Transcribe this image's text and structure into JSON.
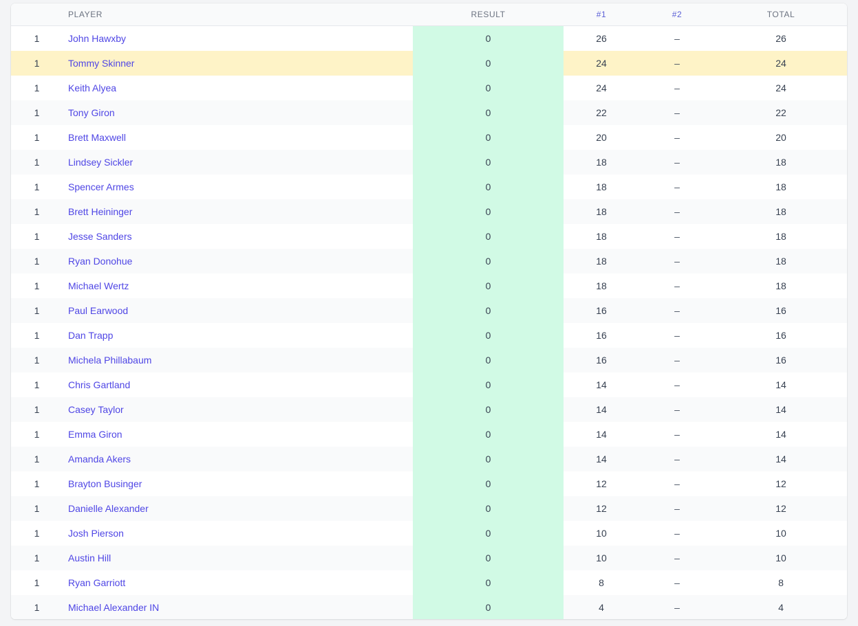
{
  "columns": {
    "position": "",
    "player": "PLAYER",
    "result": "RESULT",
    "round1": "#1",
    "round2": "#2",
    "total": "TOTAL"
  },
  "highlight_color": "#fef3c7",
  "result_column_color": "#d1fae5",
  "link_color": "#4f46e5",
  "rows": [
    {
      "pos": "1",
      "player": "John Hawxby",
      "result": "0",
      "r1": "26",
      "r2": "–",
      "total": "26"
    },
    {
      "pos": "1",
      "player": "Tommy Skinner",
      "result": "0",
      "r1": "24",
      "r2": "–",
      "total": "24",
      "highlight": true
    },
    {
      "pos": "1",
      "player": "Keith Alyea",
      "result": "0",
      "r1": "24",
      "r2": "–",
      "total": "24"
    },
    {
      "pos": "1",
      "player": "Tony Giron",
      "result": "0",
      "r1": "22",
      "r2": "–",
      "total": "22"
    },
    {
      "pos": "1",
      "player": "Brett Maxwell",
      "result": "0",
      "r1": "20",
      "r2": "–",
      "total": "20"
    },
    {
      "pos": "1",
      "player": "Lindsey Sickler",
      "result": "0",
      "r1": "18",
      "r2": "–",
      "total": "18"
    },
    {
      "pos": "1",
      "player": "Spencer Armes",
      "result": "0",
      "r1": "18",
      "r2": "–",
      "total": "18"
    },
    {
      "pos": "1",
      "player": "Brett Heininger",
      "result": "0",
      "r1": "18",
      "r2": "–",
      "total": "18"
    },
    {
      "pos": "1",
      "player": "Jesse Sanders",
      "result": "0",
      "r1": "18",
      "r2": "–",
      "total": "18"
    },
    {
      "pos": "1",
      "player": "Ryan Donohue",
      "result": "0",
      "r1": "18",
      "r2": "–",
      "total": "18"
    },
    {
      "pos": "1",
      "player": "Michael Wertz",
      "result": "0",
      "r1": "18",
      "r2": "–",
      "total": "18"
    },
    {
      "pos": "1",
      "player": "Paul Earwood",
      "result": "0",
      "r1": "16",
      "r2": "–",
      "total": "16"
    },
    {
      "pos": "1",
      "player": "Dan Trapp",
      "result": "0",
      "r1": "16",
      "r2": "–",
      "total": "16"
    },
    {
      "pos": "1",
      "player": "Michela Phillabaum",
      "result": "0",
      "r1": "16",
      "r2": "–",
      "total": "16"
    },
    {
      "pos": "1",
      "player": "Chris Gartland",
      "result": "0",
      "r1": "14",
      "r2": "–",
      "total": "14"
    },
    {
      "pos": "1",
      "player": "Casey Taylor",
      "result": "0",
      "r1": "14",
      "r2": "–",
      "total": "14"
    },
    {
      "pos": "1",
      "player": "Emma Giron",
      "result": "0",
      "r1": "14",
      "r2": "–",
      "total": "14"
    },
    {
      "pos": "1",
      "player": "Amanda Akers",
      "result": "0",
      "r1": "14",
      "r2": "–",
      "total": "14"
    },
    {
      "pos": "1",
      "player": "Brayton Businger",
      "result": "0",
      "r1": "12",
      "r2": "–",
      "total": "12"
    },
    {
      "pos": "1",
      "player": "Danielle Alexander",
      "result": "0",
      "r1": "12",
      "r2": "–",
      "total": "12"
    },
    {
      "pos": "1",
      "player": "Josh Pierson",
      "result": "0",
      "r1": "10",
      "r2": "–",
      "total": "10"
    },
    {
      "pos": "1",
      "player": "Austin Hill",
      "result": "0",
      "r1": "10",
      "r2": "–",
      "total": "10"
    },
    {
      "pos": "1",
      "player": "Ryan Garriott",
      "result": "0",
      "r1": "8",
      "r2": "–",
      "total": "8"
    },
    {
      "pos": "1",
      "player": "Michael Alexander IN",
      "result": "0",
      "r1": "4",
      "r2": "–",
      "total": "4"
    }
  ]
}
